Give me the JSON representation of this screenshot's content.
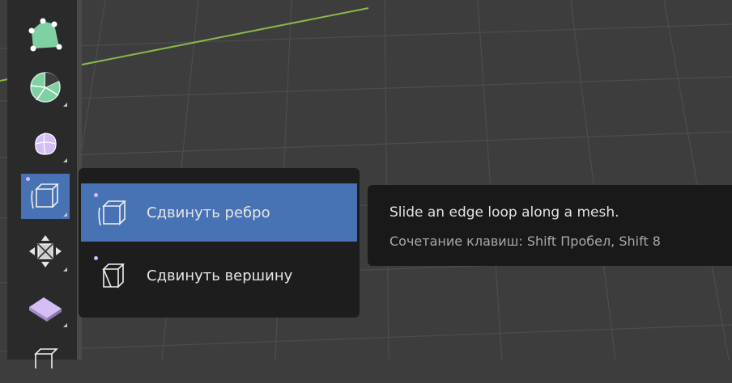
{
  "toolbar": {
    "tools": [
      {
        "name": "poly-build-icon"
      },
      {
        "name": "spin-icon"
      },
      {
        "name": "smooth-icon"
      },
      {
        "name": "edge-slide-icon",
        "active": true
      },
      {
        "name": "shrink-fatten-icon"
      },
      {
        "name": "shear-icon"
      },
      {
        "name": "to-sphere-icon"
      }
    ]
  },
  "flyout": {
    "items": [
      {
        "label": "Сдвинуть ребро",
        "icon": "edge-slide-icon",
        "active": true
      },
      {
        "label": "Сдвинуть вершину",
        "icon": "vertex-slide-icon",
        "active": false
      }
    ]
  },
  "tooltip": {
    "title": "Slide an edge loop along a mesh.",
    "shortcut": "Сочетание клавиш: Shift Пробел, Shift 8"
  },
  "colors": {
    "accent": "#4772b3",
    "tool_green": "#7fd1a4",
    "tool_purple": "#d5bdf5",
    "axis_line": "#8ab84a"
  }
}
